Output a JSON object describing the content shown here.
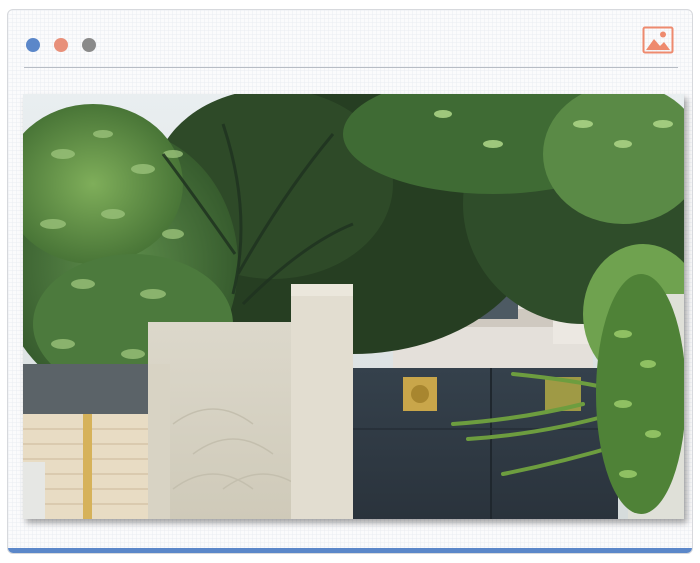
{
  "window": {
    "controls": [
      {
        "name": "dot-blue",
        "color": "#5b87c9"
      },
      {
        "name": "dot-salmon",
        "color": "#e8907a"
      },
      {
        "name": "dot-gray",
        "color": "#8a8a8a"
      }
    ],
    "icon": "image-icon",
    "icon_color": "#ee8a6e",
    "accent_bar_color": "#5b87c9"
  },
  "photo": {
    "subject": "",
    "alt": ""
  }
}
